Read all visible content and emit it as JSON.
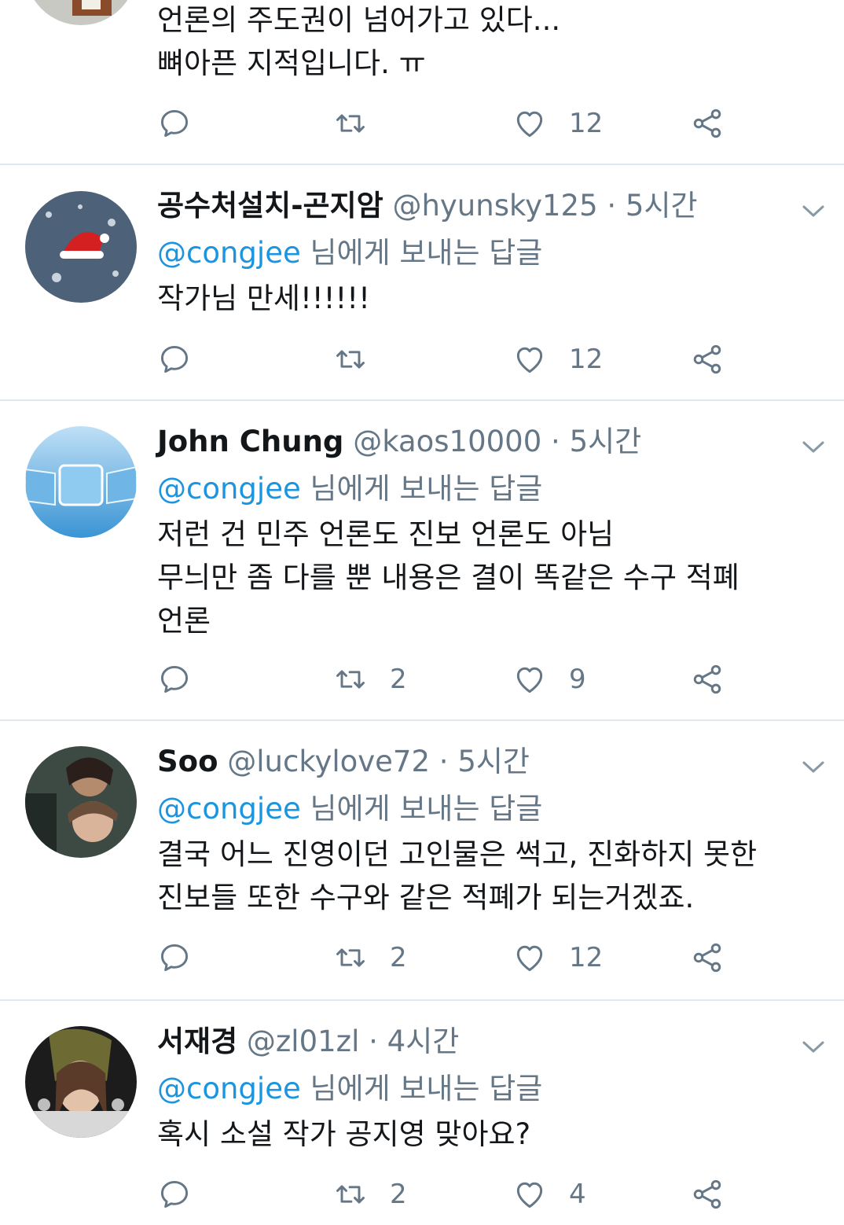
{
  "tweets": [
    {
      "name": "",
      "handle": "",
      "time": "",
      "reply_to": "",
      "reply_suffix": "",
      "lines": [
        "언론의 주도권이 넘어가고 있다...",
        "뼈아픈 지적입니다.  ㅠ"
      ],
      "counts": {
        "reply": "",
        "retweet": "",
        "like": "12"
      }
    },
    {
      "name": "공수처설치-곤지암",
      "handle": "@hyunsky125",
      "time": "5시간",
      "reply_to": "@congjee",
      "reply_suffix": " 님에게 보내는 답글",
      "lines": [
        "작가님 만세!!!!!!"
      ],
      "counts": {
        "reply": "",
        "retweet": "",
        "like": "12"
      }
    },
    {
      "name": "John Chung",
      "handle": "@kaos10000",
      "time": "5시간",
      "reply_to": "@congjee",
      "reply_suffix": " 님에게 보내는 답글",
      "lines": [
        "저런 건 민주 언론도 진보 언론도 아님",
        "무늬만 좀 다를 뿐 내용은 결이 똑같은 수구 적폐",
        "언론"
      ],
      "counts": {
        "reply": "",
        "retweet": "2",
        "like": "9"
      }
    },
    {
      "name": "Soo",
      "handle": "@luckylove72",
      "time": "5시간",
      "reply_to": "@congjee",
      "reply_suffix": " 님에게 보내는 답글",
      "lines": [
        "결국 어느 진영이던 고인물은 썩고, 진화하지 못한",
        "진보들 또한 수구와 같은 적폐가 되는거겠죠."
      ],
      "counts": {
        "reply": "",
        "retweet": "2",
        "like": "12"
      }
    },
    {
      "name": "서재경",
      "handle": "@zl01zl",
      "time": "4시간",
      "reply_to": "@congjee",
      "reply_suffix": " 님에게 보내는 답글",
      "lines": [
        "혹시 소설 작가 공지영 맞아요?"
      ],
      "counts": {
        "reply": "",
        "retweet": "2",
        "like": "4"
      }
    }
  ],
  "separator": " · ",
  "icons": {
    "reply": "reply-icon",
    "retweet": "retweet-icon",
    "like": "heart-icon",
    "share": "share-icon",
    "caret": "chevron-down-icon"
  },
  "colors": {
    "text": "#14171a",
    "muted": "#657786",
    "link": "#1b95e0",
    "divider": "#e1e8ed"
  }
}
